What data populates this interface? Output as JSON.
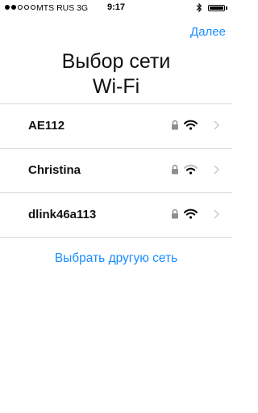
{
  "status_bar": {
    "carrier": "MTS RUS",
    "network_type": "3G",
    "time": "9:17",
    "signal_bars_filled": 2,
    "signal_bars_total": 5,
    "battery_level": 1.0
  },
  "header": {
    "next_label": "Далее",
    "title_line1": "Выбор сети",
    "title_line2": "Wi-Fi"
  },
  "networks": [
    {
      "name": "AE112",
      "secured": true,
      "signal": "full"
    },
    {
      "name": "Christina",
      "secured": true,
      "signal": "weak"
    },
    {
      "name": "dlink46a113",
      "secured": true,
      "signal": "full"
    }
  ],
  "other_network_label": "Выбрать другую сеть",
  "colors": {
    "accent": "#1a8cff",
    "wifi_full": "#000000",
    "wifi_dim": "#bdbdbd",
    "lock": "#8e8e8e",
    "chevron": "#c7c7cc"
  }
}
